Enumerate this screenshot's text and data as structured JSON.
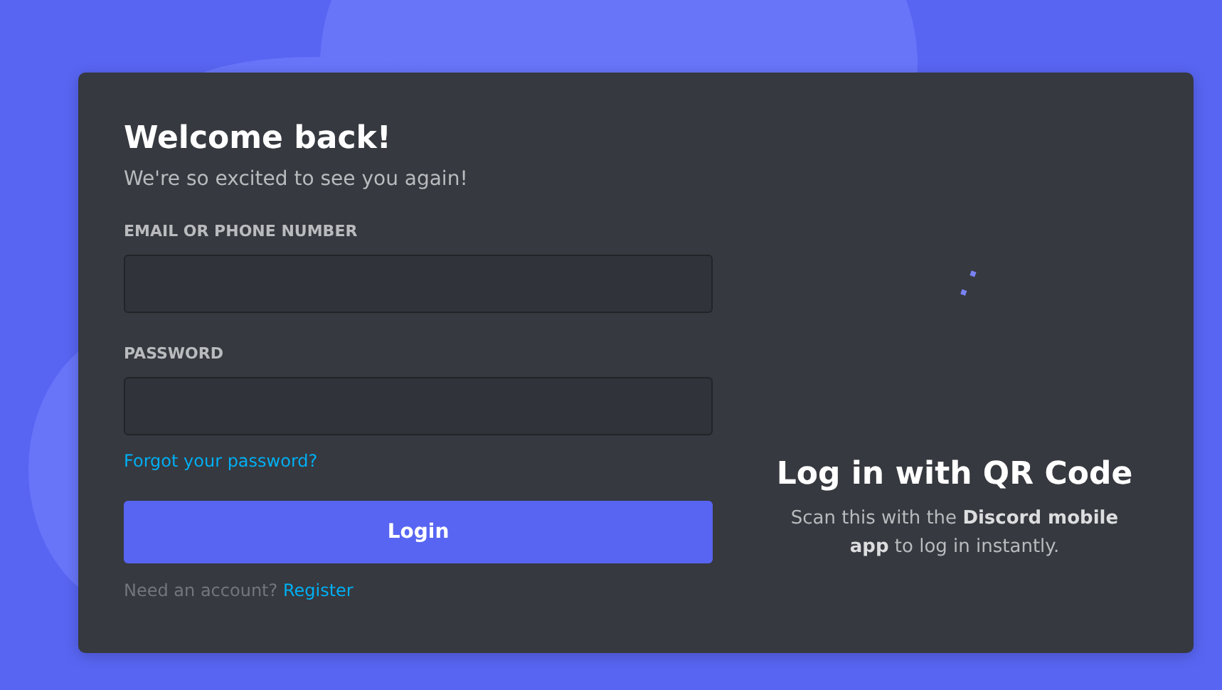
{
  "login_form": {
    "title": "Welcome back!",
    "subtitle": "We're so excited to see you again!",
    "fields": [
      {
        "label": "EMAIL OR PHONE NUMBER"
      },
      {
        "label": "PASSWORD"
      }
    ],
    "forgot_link": "Forgot your password?",
    "login_button": "Login",
    "register_prompt": "Need an account?",
    "register_link": "Register"
  },
  "qr_login": {
    "title": "Log in with QR Code",
    "description": "Scan this with the **Discord mobile app** to log in instantly."
  }
}
